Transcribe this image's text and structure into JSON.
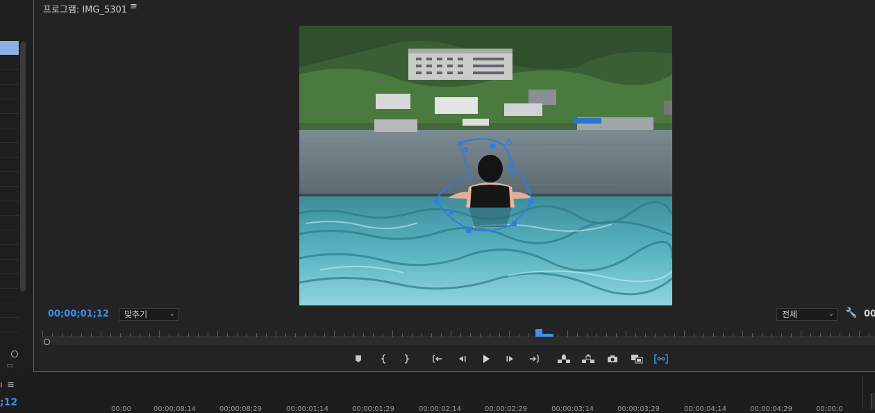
{
  "program_monitor": {
    "title": "프로그램: IMG_5301",
    "menu_glyph": "≡",
    "timecode": "00;00;01;12",
    "fit_dropdown": "맞추기",
    "resolution_dropdown": "전체",
    "timecode_right": "00"
  },
  "controls": [
    {
      "name": "add-marker-button",
      "glyph": "⬟"
    },
    {
      "name": "mark-in-button",
      "glyph": "{"
    },
    {
      "name": "mark-out-button",
      "glyph": "}"
    },
    {
      "name": "go-to-in-button",
      "glyph": "{←"
    },
    {
      "name": "step-back-button",
      "glyph": "◀I"
    },
    {
      "name": "play-button",
      "glyph": "▶"
    },
    {
      "name": "step-forward-button",
      "glyph": "I▶"
    },
    {
      "name": "go-to-out-button",
      "glyph": "→}"
    },
    {
      "name": "lift-button",
      "glyph": "⏏"
    },
    {
      "name": "extract-button",
      "glyph": "⏏"
    },
    {
      "name": "export-frame-button",
      "glyph": "📷"
    },
    {
      "name": "comparison-view-button",
      "glyph": "▣"
    },
    {
      "name": "safe-margins-button",
      "glyph": "[⊶]"
    }
  ],
  "timeline": {
    "menu_glyph": "≡",
    "panel_marker": "ı",
    "timecode": ";12",
    "time_labels": [
      "00;00",
      "00;00;08;14",
      "00;00;08;29",
      "00;00;01;14",
      "00;00;01;29",
      "00;00;02;14",
      "00;00;02;29",
      "00;00;03;14",
      "00;00;03;29",
      "00;00;04;14",
      "00;00;04;29",
      "00;00;0"
    ]
  },
  "colors": {
    "accent": "#3e8ff0",
    "mask": "#2f7de0"
  }
}
